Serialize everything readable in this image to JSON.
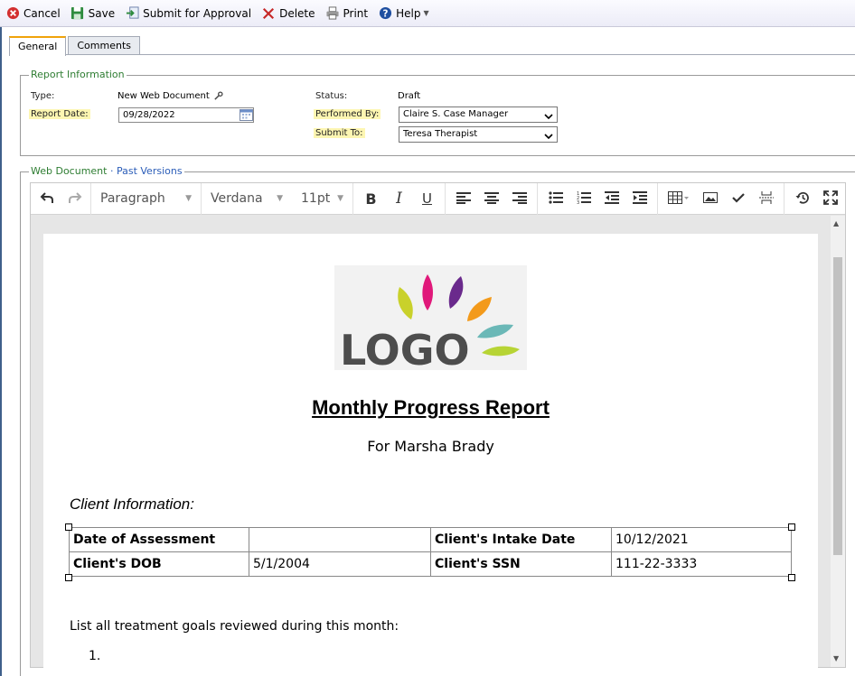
{
  "toolbar": {
    "cancel": "Cancel",
    "save": "Save",
    "submit": "Submit for Approval",
    "delete": "Delete",
    "print": "Print",
    "help": "Help"
  },
  "tabs": [
    "General",
    "Comments"
  ],
  "report_info": {
    "legend": "Report Information",
    "type_label": "Type:",
    "type_value": "New Web Document",
    "report_date_label": "Report Date:",
    "report_date_value": "09/28/2022",
    "status_label": "Status:",
    "status_value": "Draft",
    "performed_by_label": "Performed By:",
    "performed_by_value": "Claire S. Case Manager",
    "submit_to_label": "Submit To:",
    "submit_to_value": "Teresa Therapist"
  },
  "web_document": {
    "legend": "Web Document",
    "separator": "·",
    "past_versions": "Past Versions"
  },
  "editor": {
    "block_format": "Paragraph",
    "font_family": "Verdana",
    "font_size": "11pt"
  },
  "document": {
    "logo_text": "LOGO",
    "title": "Monthly Progress Report",
    "subtitle": "For Marsha Brady",
    "section_heading": "Client Information:",
    "table": [
      [
        "Date of Assessment",
        "",
        "Client's Intake Date",
        "10/12/2021"
      ],
      [
        "Client's DOB",
        "5/1/2004",
        "Client's SSN",
        "111-22-3333"
      ]
    ],
    "paragraph": "List all treatment goals reviewed during this month:",
    "list_marker": "1."
  },
  "colors": {
    "legend_green": "#2e7d32",
    "link_blue": "#2b5db8",
    "required_highlight": "#fdf6b2",
    "active_tab_accent": "#f0a30a"
  }
}
